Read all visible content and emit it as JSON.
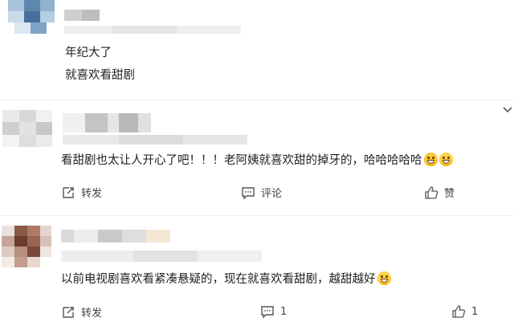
{
  "comments": [
    {
      "lines": [
        "年纪大了",
        "就喜欢看甜剧"
      ]
    },
    {
      "text": "看甜剧也太让人开心了吧！！！老阿姨就喜欢甜的掉牙的，哈哈哈哈哈",
      "emojis": [
        "crying-laughing-emoji",
        "grinning-emoji"
      ],
      "actions": {
        "repost": "转发",
        "comment": "评论",
        "like": "赞"
      }
    },
    {
      "text": "以前电视剧喜欢看紧凑悬疑的，现在就喜欢看甜剧，越甜越好",
      "emojis": [
        "grinning-emoji"
      ],
      "actions": {
        "repost": "转发",
        "comment_count": "1",
        "like_count": "1"
      }
    }
  ],
  "icons": {
    "repost": "repost-icon",
    "comment": "comment-icon",
    "like": "thumbs-up-icon",
    "collapse": "chevron-down-icon"
  },
  "colors": {
    "text": "#1f1f1f",
    "muted": "#444444",
    "emoji": "#ffd24a"
  }
}
